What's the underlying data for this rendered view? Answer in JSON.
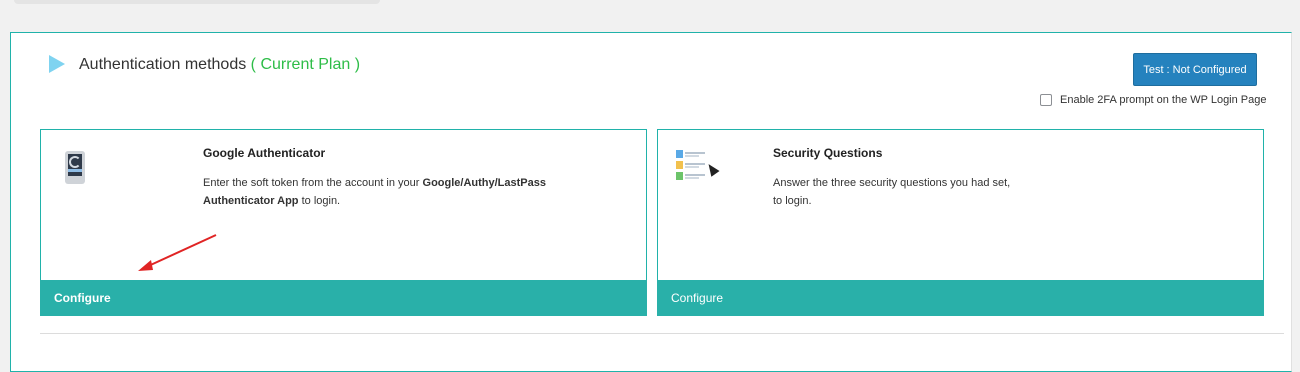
{
  "header": {
    "title": "Authentication methods",
    "plan": "( Current Plan )",
    "test_button": "Test : Not Configured",
    "prompt_label": "Enable 2FA prompt on the WP Login Page"
  },
  "methods": [
    {
      "title": "Google Authenticator",
      "desc_pre": "Enter the soft token from the account in your ",
      "desc_bold": "Google/Authy/LastPass Authenticator App",
      "desc_post": " to login.",
      "footer": "Configure"
    },
    {
      "title": "Security Questions",
      "desc_line1": "Answer the three security questions you had set,",
      "desc_line2": "to login.",
      "footer": "Configure"
    }
  ],
  "colors": {
    "accent": "#20b2aa",
    "footer": "#29b0a9",
    "button": "#2582be",
    "plan": "#2ebd48",
    "arrow": "#e02424"
  }
}
